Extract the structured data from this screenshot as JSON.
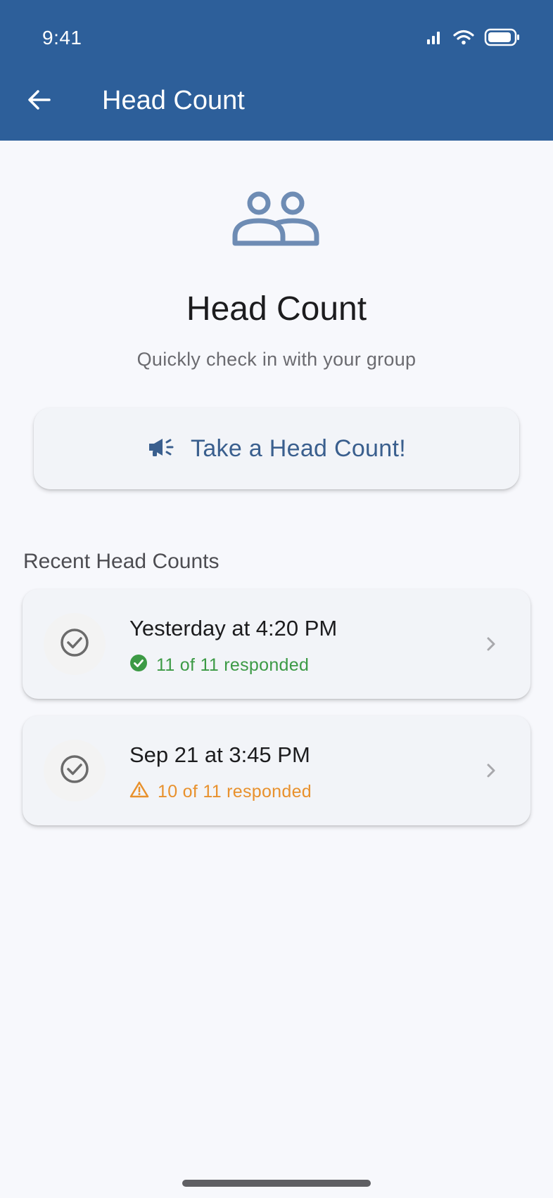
{
  "status_bar": {
    "time": "9:41",
    "icons": [
      "signal-icon",
      "wifi-icon",
      "battery-icon"
    ]
  },
  "app_bar": {
    "title": "Head Count",
    "back_icon": "arrow-left-icon",
    "background_color": "#2d5f9a"
  },
  "hero": {
    "icon": "people-icon",
    "title": "Head Count",
    "subtitle": "Quickly check in with your group"
  },
  "primary_action": {
    "icon": "megaphone-icon",
    "label": "Take a Head Count!"
  },
  "recent": {
    "title": "Recent Head Counts",
    "items": [
      {
        "title": "Yesterday at 4:20 PM",
        "status_text": "11 of 11 responded",
        "status": "complete",
        "status_icon": "check-circle-icon",
        "status_color": "#3c9a45"
      },
      {
        "title": "Sep 21 at 3:45 PM",
        "status_text": "10 of 11 responded",
        "status": "incomplete",
        "status_icon": "warning-triangle-icon",
        "status_color": "#e8912d"
      }
    ]
  },
  "colors": {
    "accent": "#2d5f9a",
    "button_text": "#3a5f8e",
    "success": "#3c9a45",
    "warning": "#e8912d",
    "background": "#f7f8fc"
  }
}
